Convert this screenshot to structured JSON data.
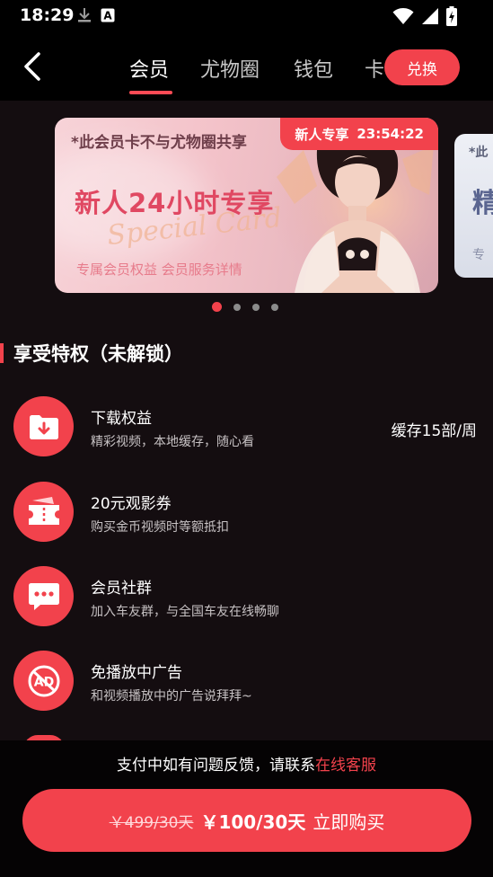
{
  "status_bar": {
    "time": "18:29",
    "icons_left": [
      "download-icon",
      "font-a-icon"
    ],
    "icons_right": [
      "wifi-icon",
      "signal-icon",
      "battery-charging-icon"
    ]
  },
  "header": {
    "tabs": [
      {
        "label": "会员",
        "active": true
      },
      {
        "label": "尤物圈",
        "active": false
      },
      {
        "label": "钱包",
        "active": false
      },
      {
        "label": "卡",
        "active": false
      }
    ],
    "redeem_label": "兑换"
  },
  "carousel": {
    "cards": [
      {
        "notice": "*此会员卡不与尤物圈共享",
        "badge_prefix": "新人专享",
        "countdown": "23:54:22",
        "title": "新人24小时专享",
        "script": "Special Card",
        "links": "专属会员权益 会员服务详情"
      },
      {
        "notice": "*此",
        "title": "精",
        "link": "专"
      }
    ],
    "active_index": 0,
    "dot_count": 4
  },
  "section": {
    "title": "享受特权（未解锁）"
  },
  "benefits": [
    {
      "icon": "download-icon",
      "name": "下载权益",
      "desc": "精彩视频，本地缓存，随心看",
      "extra": "缓存15部/周"
    },
    {
      "icon": "ticket-icon",
      "name": "20元观影券",
      "desc": "购买金币视频时等额抵扣",
      "extra": ""
    },
    {
      "icon": "chat-icon",
      "name": "会员社群",
      "desc": "加入车友群，与全国车友在线畅聊",
      "extra": ""
    },
    {
      "icon": "no-ads-icon",
      "name": "免播放中广告",
      "desc": "和视频播放中的广告说拜拜~",
      "extra": ""
    }
  ],
  "footer": {
    "help_text": "支付中如有问题反馈，请联系",
    "help_link": "在线客服",
    "old_price": "￥499/30天",
    "new_price": "￥100/30天",
    "buy_label": "立即购买"
  },
  "colors": {
    "accent": "#f2424c",
    "background": "#140d10",
    "card_title": "#e04862"
  }
}
